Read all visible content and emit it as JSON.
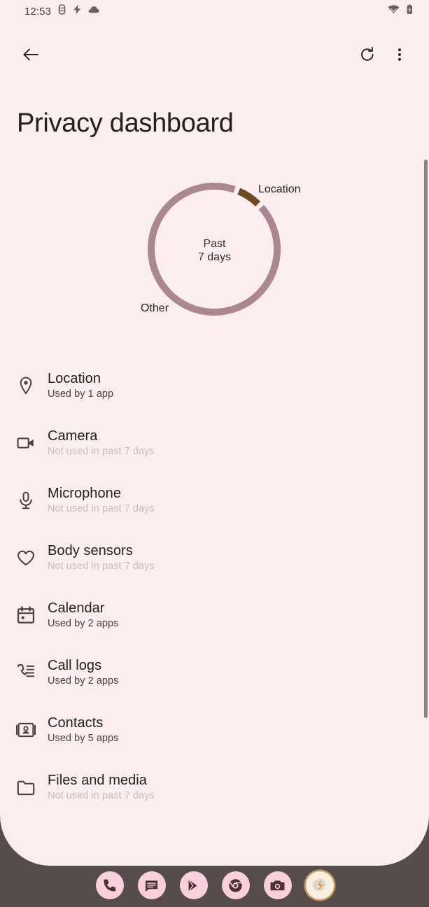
{
  "status_bar": {
    "clock": "12:53",
    "left_icons": [
      "vibrate-icon",
      "lightning-bolt-icon",
      "cloud-icon"
    ],
    "right_icons": [
      "wifi-icon",
      "battery-charging-icon"
    ]
  },
  "action_bar": {
    "back_label": "back-arrow-icon",
    "refresh_label": "refresh-icon",
    "overflow_label": "more-options-icon"
  },
  "header": {
    "title": "Privacy dashboard"
  },
  "chart_data": {
    "type": "pie",
    "title": "",
    "center_line1": "Past",
    "center_line2": "7 days",
    "legend_position": "around-arc",
    "categories": [
      "Location",
      "Other"
    ],
    "values": [
      7,
      93
    ],
    "colors": [
      "#6e4a23",
      "#ab8891"
    ],
    "annotations": [
      {
        "label": "Location",
        "value": 7
      },
      {
        "label": "Other",
        "value": 93
      }
    ],
    "grid": false
  },
  "permissions": [
    {
      "icon": "location-pin-icon",
      "title": "Location",
      "subtitle": "Used by 1 app",
      "state": "active"
    },
    {
      "icon": "video-camera-icon",
      "title": "Camera",
      "subtitle": "Not used in past 7 days",
      "state": "idle"
    },
    {
      "icon": "microphone-icon",
      "title": "Microphone",
      "subtitle": "Not used in past 7 days",
      "state": "idle"
    },
    {
      "icon": "heart-icon",
      "title": "Body sensors",
      "subtitle": "Not used in past 7 days",
      "state": "idle"
    },
    {
      "icon": "calendar-icon",
      "title": "Calendar",
      "subtitle": "Used by 2 apps",
      "state": "active"
    },
    {
      "icon": "call-logs-icon",
      "title": "Call logs",
      "subtitle": "Used by 2 apps",
      "state": "active"
    },
    {
      "icon": "contacts-icon",
      "title": "Contacts",
      "subtitle": "Used by 5 apps",
      "state": "active"
    },
    {
      "icon": "folder-icon",
      "title": "Files and media",
      "subtitle": "Not used in past 7 days",
      "state": "idle"
    }
  ],
  "dock": {
    "items": [
      {
        "name": "phone-app-icon",
        "label": "Phone"
      },
      {
        "name": "messages-app-icon",
        "label": "Messages"
      },
      {
        "name": "play-store-app-icon",
        "label": "Play Store"
      },
      {
        "name": "chrome-app-icon",
        "label": "Chrome"
      },
      {
        "name": "camera-app-icon",
        "label": "Camera"
      },
      {
        "name": "automation-app-icon",
        "label": "Automate"
      }
    ]
  },
  "colors": {
    "background": "#faeeee",
    "system_background": "#564c4c",
    "text_primary": "#241f20",
    "text_idle": "#cdbcbe",
    "arc_other": "#ab8891",
    "arc_location": "#6e4a23",
    "dock_icon_bg": "#f9cfdb"
  }
}
